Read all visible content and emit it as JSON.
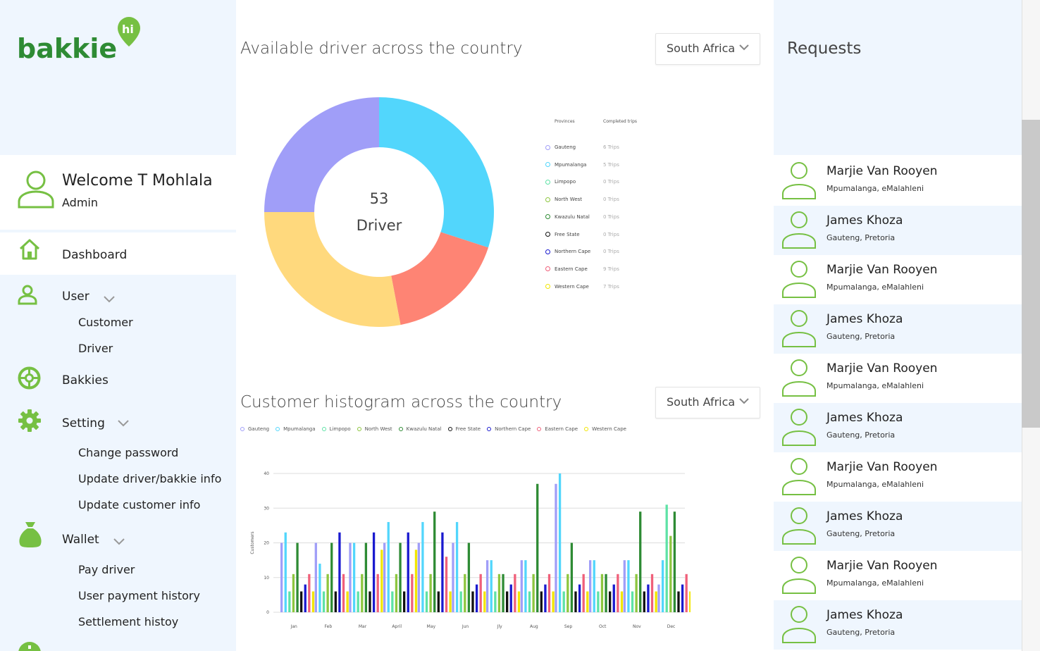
{
  "brand": {
    "logo_text": "bakkie",
    "logo_badge": "hi",
    "color": "#2e8b34",
    "accent": "#76c043"
  },
  "welcome": {
    "name": "Welcome T Mohlala",
    "role": "Admin"
  },
  "nav": {
    "dashboard": "Dashboard",
    "user": "User",
    "user_sub": [
      "Customer",
      "Driver"
    ],
    "bakkies": "Bakkies",
    "setting": "Setting",
    "setting_sub": [
      "Change password",
      "Update driver/bakkie info",
      "Update customer info"
    ],
    "wallet": "Wallet",
    "wallet_sub": [
      "Pay driver",
      "User payment history",
      "Settlement histoy"
    ]
  },
  "donut": {
    "title": "Available driver across the country",
    "dropdown": "South Africa",
    "center_value": "53",
    "center_label": "Driver",
    "legend_head_left": "Provinces",
    "legend_head_right": "Completed trips",
    "legend": [
      {
        "name": "Gauteng",
        "value": "6 Trips",
        "color": "#a09ef8"
      },
      {
        "name": "Mpumalanga",
        "value": "5 Trips",
        "color": "#52d6fc"
      },
      {
        "name": "Limpopo",
        "value": "0 Trips",
        "color": "#5ee2a6"
      },
      {
        "name": "North West",
        "value": "0 Trips",
        "color": "#8dc63f"
      },
      {
        "name": "Kwazulu Natal",
        "value": "0 Trips",
        "color": "#2e8b34"
      },
      {
        "name": "Free State",
        "value": "0 Trips",
        "color": "#111111"
      },
      {
        "name": "Northern Cape",
        "value": "0 Trips",
        "color": "#1a1acf"
      },
      {
        "name": "Eastern Cape",
        "value": "9 Trips",
        "color": "#f0607a"
      },
      {
        "name": "Western Cape",
        "value": "7 Trips",
        "color": "#f2e600"
      }
    ]
  },
  "chart_data": [
    {
      "type": "pie",
      "slices": [
        {
          "value": 0.3,
          "color": "#52d6fc"
        },
        {
          "value": 0.17,
          "color": "#fe8474"
        },
        {
          "value": 0.28,
          "color": "#ffd97d"
        },
        {
          "value": 0.25,
          "color": "#a09ef8"
        }
      ],
      "center_value": "53",
      "center_label": "Driver"
    },
    {
      "type": "bar",
      "title": "Customer histogram across the country",
      "ylabel": "Customers",
      "ylim": [
        0,
        40
      ],
      "yticks": [
        0,
        10,
        20,
        30,
        40
      ],
      "categories": [
        "Jan",
        "Feb",
        "Mar",
        "April",
        "May",
        "Jun",
        "Jly",
        "Aug",
        "Sep",
        "Oct",
        "Nov",
        "Dec"
      ],
      "series": [
        {
          "name": "Gauteng",
          "color": "#a09ef8",
          "values": [
            20,
            20,
            20,
            20,
            20,
            20,
            15,
            15,
            37,
            15,
            15,
            8
          ]
        },
        {
          "name": "Mpumalanga",
          "color": "#52d6fc",
          "values": [
            23,
            14,
            20,
            26,
            26,
            26,
            15,
            15,
            40,
            15,
            15,
            15
          ]
        },
        {
          "name": "Limpopo",
          "color": "#5ee2a6",
          "values": [
            6,
            6,
            6,
            6,
            6,
            6,
            6,
            6,
            6,
            6,
            6,
            31
          ]
        },
        {
          "name": "North West",
          "color": "#8dc63f",
          "values": [
            11,
            11,
            11,
            11,
            11,
            11,
            11,
            11,
            11,
            11,
            11,
            22
          ]
        },
        {
          "name": "Kwazulu Natal",
          "color": "#2e8b34",
          "values": [
            20,
            20,
            20,
            20,
            29,
            20,
            11,
            37,
            20,
            11,
            29,
            29
          ]
        },
        {
          "name": "Free State",
          "color": "#111111",
          "values": [
            6,
            6,
            6,
            6,
            6,
            6,
            6,
            6,
            6,
            6,
            6,
            6
          ]
        },
        {
          "name": "Northern Cape",
          "color": "#1a1acf",
          "values": [
            8,
            23,
            23,
            23,
            23,
            8,
            8,
            8,
            8,
            8,
            8,
            8
          ]
        },
        {
          "name": "Eastern Cape",
          "color": "#f0607a",
          "values": [
            11,
            11,
            11,
            11,
            16,
            11,
            11,
            11,
            11,
            11,
            11,
            11
          ]
        },
        {
          "name": "Western Cape",
          "color": "#f2e600",
          "values": [
            6,
            6,
            18,
            18,
            6,
            6,
            6,
            6,
            6,
            6,
            6,
            6
          ]
        }
      ]
    }
  ],
  "histogram": {
    "title": "Customer histogram across the country",
    "dropdown": "South Africa",
    "ylabel": "Customers"
  },
  "requests": {
    "title": "Requests",
    "items": [
      {
        "name": "Marjie Van Rooyen",
        "location": "Mpumalanga, eMalahleni"
      },
      {
        "name": "James Khoza",
        "location": "Gauteng, Pretoria"
      },
      {
        "name": "Marjie Van Rooyen",
        "location": "Mpumalanga, eMalahleni"
      },
      {
        "name": "James Khoza",
        "location": "Gauteng, Pretoria"
      },
      {
        "name": "Marjie Van Rooyen",
        "location": "Mpumalanga, eMalahleni"
      },
      {
        "name": "James Khoza",
        "location": "Gauteng, Pretoria"
      },
      {
        "name": "Marjie Van Rooyen",
        "location": "Mpumalanga, eMalahleni"
      },
      {
        "name": "James Khoza",
        "location": "Gauteng, Pretoria"
      },
      {
        "name": "Marjie Van Rooyen",
        "location": "Mpumalanga, eMalahleni"
      },
      {
        "name": "James Khoza",
        "location": "Gauteng, Pretoria"
      }
    ]
  }
}
